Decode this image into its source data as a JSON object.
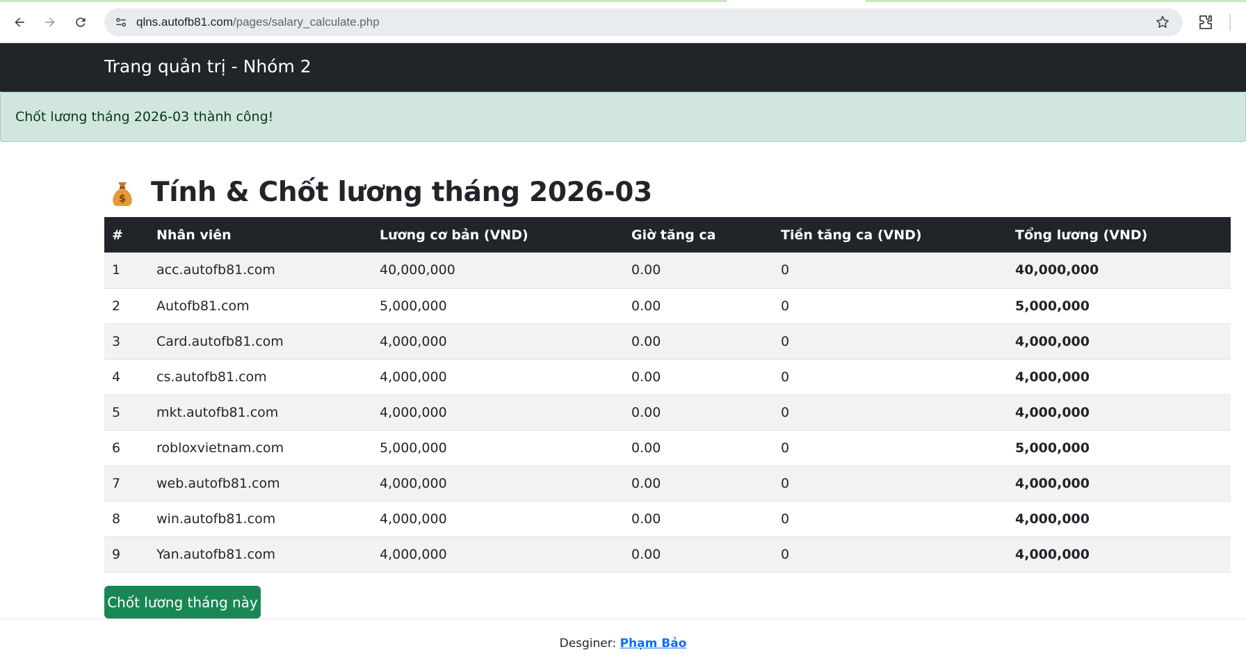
{
  "browser": {
    "url_host": "qlns.autofb81.com",
    "url_path": "/pages/salary_calculate.php"
  },
  "navbar": {
    "brand": "Trang quản trị - Nhóm 2"
  },
  "alert": {
    "message": "Chốt lương tháng 2026-03 thành công!"
  },
  "page": {
    "icon": "money-bag-icon",
    "title": "Tính & Chốt lương tháng 2026-03"
  },
  "table": {
    "headers": [
      "#",
      "Nhân viên",
      "Lương cơ bản (VND)",
      "Giờ tăng ca",
      "Tiền tăng ca (VND)",
      "Tổng lương (VND)"
    ],
    "rows": [
      [
        "1",
        "acc.autofb81.com",
        "40,000,000",
        "0.00",
        "0",
        "40,000,000"
      ],
      [
        "2",
        "Autofb81.com",
        "5,000,000",
        "0.00",
        "0",
        "5,000,000"
      ],
      [
        "3",
        "Card.autofb81.com",
        "4,000,000",
        "0.00",
        "0",
        "4,000,000"
      ],
      [
        "4",
        "cs.autofb81.com",
        "4,000,000",
        "0.00",
        "0",
        "4,000,000"
      ],
      [
        "5",
        "mkt.autofb81.com",
        "4,000,000",
        "0.00",
        "0",
        "4,000,000"
      ],
      [
        "6",
        "robloxvietnam.com",
        "5,000,000",
        "0.00",
        "0",
        "5,000,000"
      ],
      [
        "7",
        "web.autofb81.com",
        "4,000,000",
        "0.00",
        "0",
        "4,000,000"
      ],
      [
        "8",
        "win.autofb81.com",
        "4,000,000",
        "0.00",
        "0",
        "4,000,000"
      ],
      [
        "9",
        "Yan.autofb81.com",
        "4,000,000",
        "0.00",
        "0",
        "4,000,000"
      ]
    ]
  },
  "actions": {
    "close_salary_label": "Chốt lương tháng này"
  },
  "footer": {
    "designer_label": "Desginer:",
    "designer_name": "Phạm Bảo"
  },
  "colors": {
    "navbar_bg": "#212529",
    "alert_bg": "#d1e7dd",
    "button_bg": "#198754",
    "link": "#0d6efd"
  }
}
